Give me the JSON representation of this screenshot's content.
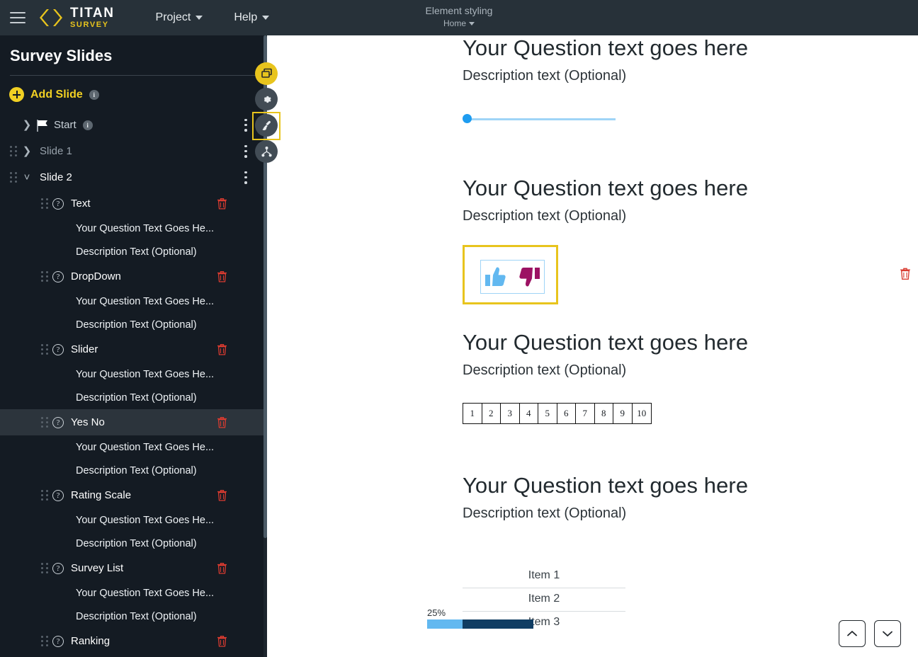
{
  "topbar": {
    "menu_icon": "hamburger-icon",
    "logo_primary": "TITAN",
    "logo_secondary": "SURVEY",
    "menus": [
      {
        "label": "Project"
      },
      {
        "label": "Help"
      }
    ],
    "center_title": "Element styling",
    "center_subtitle": "Home"
  },
  "sidebar": {
    "title": "Survey Slides",
    "add_slide_label": "Add Slide",
    "info_badge": "i",
    "tree": [
      {
        "type": "slide",
        "label": "Start",
        "icon": "flag-icon",
        "expanded": false,
        "info": "i",
        "muted": true,
        "grip": false
      },
      {
        "type": "slide",
        "label": "Slide 1",
        "expanded": false,
        "muted": true,
        "grip": true
      },
      {
        "type": "slide",
        "label": "Slide 2",
        "expanded": true,
        "muted": false,
        "grip": true
      },
      {
        "type": "element",
        "label": "Text",
        "selected": false
      },
      {
        "type": "sub",
        "label": "Your Question Text Goes He..."
      },
      {
        "type": "sub",
        "label": "Description Text (Optional)"
      },
      {
        "type": "element",
        "label": "DropDown",
        "selected": false
      },
      {
        "type": "sub",
        "label": "Your Question Text Goes He..."
      },
      {
        "type": "sub",
        "label": "Description Text (Optional)"
      },
      {
        "type": "element",
        "label": "Slider",
        "selected": false
      },
      {
        "type": "sub",
        "label": "Your Question Text Goes He..."
      },
      {
        "type": "sub",
        "label": "Description Text (Optional)"
      },
      {
        "type": "element",
        "label": "Yes No",
        "selected": true
      },
      {
        "type": "sub",
        "label": "Your Question Text Goes He..."
      },
      {
        "type": "sub",
        "label": "Description Text (Optional)"
      },
      {
        "type": "element",
        "label": "Rating Scale",
        "selected": false
      },
      {
        "type": "sub",
        "label": "Your Question Text Goes He..."
      },
      {
        "type": "sub",
        "label": "Description Text (Optional)"
      },
      {
        "type": "element",
        "label": "Survey List",
        "selected": false
      },
      {
        "type": "sub",
        "label": "Your Question Text Goes He..."
      },
      {
        "type": "sub",
        "label": "Description Text (Optional)"
      },
      {
        "type": "element",
        "label": "Ranking",
        "selected": false
      }
    ]
  },
  "fabs": [
    {
      "name": "copy-slide-icon",
      "style": "yellow"
    },
    {
      "name": "settings-gear-icon",
      "style": "dark"
    },
    {
      "name": "paint-brush-icon",
      "style": "dark",
      "selected": true
    },
    {
      "name": "sitemap-share-icon",
      "style": "dark"
    }
  ],
  "canvas": {
    "blocks": [
      {
        "id": "slider-question",
        "title": "Your Question text goes here",
        "description": "Description text (Optional)",
        "widget": "slider",
        "slider_value": 0
      },
      {
        "id": "yesno-question",
        "title": "Your Question text goes here",
        "description": "Description text (Optional)",
        "widget": "thumbs",
        "thumbs_up_color": "#62b8f0",
        "thumbs_down_color": "#9c1263",
        "selection_color": "#e8c41d"
      },
      {
        "id": "rating-question",
        "title": "Your Question text goes here",
        "description": "Description text (Optional)",
        "widget": "rating",
        "rating_values": [
          "1",
          "2",
          "3",
          "4",
          "5",
          "6",
          "7",
          "8",
          "9",
          "10"
        ]
      },
      {
        "id": "surveylist-question",
        "title": "Your Question text goes here",
        "description": "Description text (Optional)",
        "widget": "survey-list",
        "items": [
          "Item 1",
          "Item 2",
          "Item 3"
        ],
        "percent_label": "25%",
        "percent_value": 25,
        "fill_color": "#62b8f0",
        "rest_color": "#103d63"
      }
    ],
    "delete_icon": "trash-icon",
    "nav_up_icon": "chevron-up-icon",
    "nav_down_icon": "chevron-down-icon"
  },
  "colors": {
    "topbar_bg": "#273139",
    "sidebar_bg": "#141b23",
    "accent_yellow": "#e8c41d",
    "selected_row_bg": "#2c343c",
    "trash_red": "#d93b30"
  }
}
